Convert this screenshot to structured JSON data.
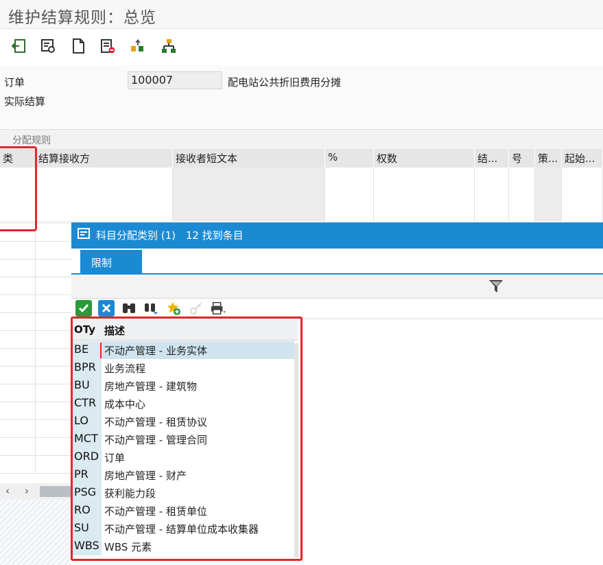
{
  "title": "维护结算规则：总览",
  "header": {
    "order_label": "订单",
    "order_value": "100007",
    "order_desc": "配电站公共折旧费用分摊",
    "type_label": "实际结算"
  },
  "rules": {
    "section_title": "分配规则",
    "columns": [
      "类",
      "结算接收方",
      "接收者短文本",
      "%",
      "权数",
      "结...",
      "号",
      "策...",
      "起始..."
    ]
  },
  "popup": {
    "title": "科目分配类别 (1)",
    "count": "12 找到条目",
    "tab": "限制",
    "list_header_code": "OTy",
    "list_header_desc": "描述",
    "items": [
      {
        "code": "BE",
        "desc": "不动产管理 - 业务实体"
      },
      {
        "code": "BPR",
        "desc": "业务流程"
      },
      {
        "code": "BU",
        "desc": "房地产管理 - 建筑物"
      },
      {
        "code": "CTR",
        "desc": "成本中心"
      },
      {
        "code": "LO",
        "desc": "不动产管理 - 租赁协议"
      },
      {
        "code": "MCT",
        "desc": "不动产管理 - 管理合同"
      },
      {
        "code": "ORD",
        "desc": "订单"
      },
      {
        "code": "PR",
        "desc": "房地产管理 - 财产"
      },
      {
        "code": "PSG",
        "desc": "获利能力段"
      },
      {
        "code": "RO",
        "desc": "不动产管理 - 租赁单位"
      },
      {
        "code": "SU",
        "desc": "不动产管理 - 结算单位成本收集器"
      },
      {
        "code": "WBS",
        "desc": "WBS 元素"
      }
    ]
  },
  "colors": {
    "accent": "#1c8ad3",
    "highlight": "#e3262a"
  }
}
